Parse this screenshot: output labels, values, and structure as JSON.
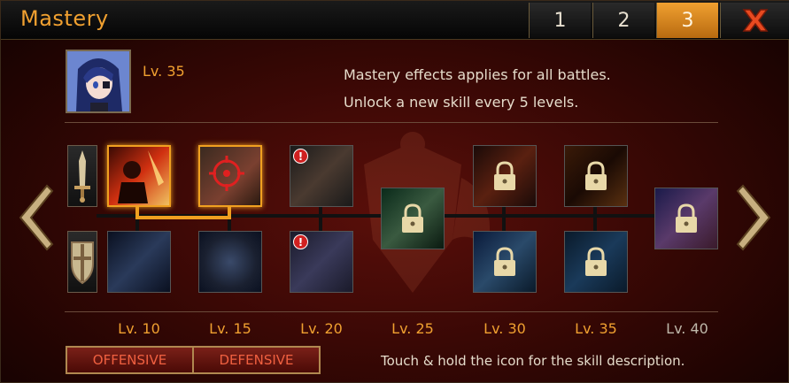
{
  "title": "Mastery",
  "tabs": [
    "1",
    "2",
    "3"
  ],
  "active_tab": "3",
  "character": {
    "level": "Lv. 35"
  },
  "info": {
    "line1": "Mastery effects applies for all battles.",
    "line2": "Unlock a new skill every 5 levels."
  },
  "levels": [
    "Lv. 10",
    "Lv. 15",
    "Lv. 20",
    "Lv. 25",
    "Lv. 30",
    "Lv. 35",
    "Lv. 40"
  ],
  "alert_glyph": "!",
  "toggle": {
    "offensive": "OFFENSIVE",
    "defensive": "DEFENSIVE"
  },
  "hint": "Touch & hold the icon for the skill description.",
  "colors": {
    "accent": "#f0a030",
    "close": "#e84a20",
    "highlight": "#f0a020"
  },
  "icons": [
    "close-icon",
    "sword-icon",
    "shield-icon",
    "lock-icon",
    "left-arrow-icon",
    "right-arrow-icon"
  ]
}
